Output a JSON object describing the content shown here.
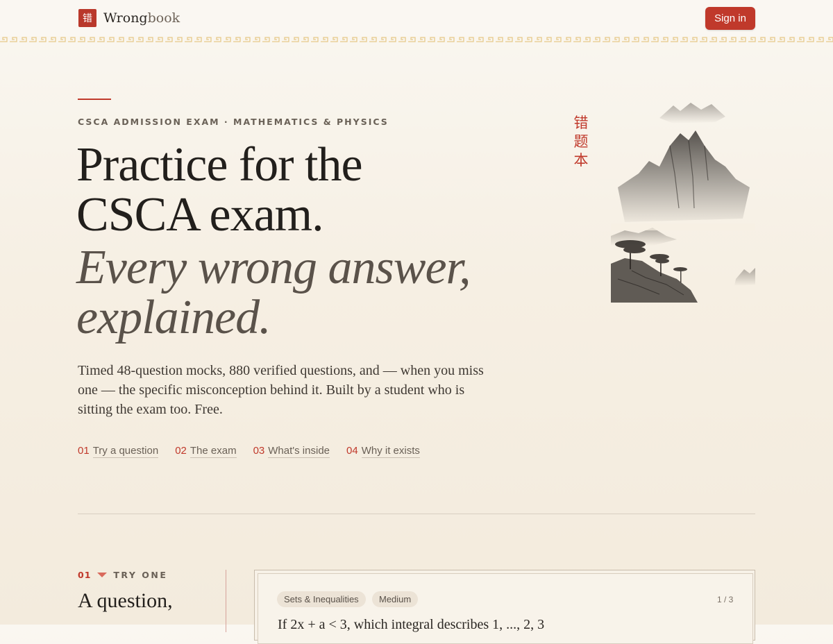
{
  "header": {
    "logo_glyph": "错",
    "brand_main": "Wrong",
    "brand_rest": "book",
    "signin_label": "Sign in"
  },
  "hero": {
    "eyebrow": "CSCA ADMISSION EXAM · MATHEMATICS & PHYSICS",
    "title_line1": "Practice for the",
    "title_line2": "CSCA exam.",
    "title_italic_line1": "Every wrong answer,",
    "title_italic_line2": "explained.",
    "lede": "Timed 48-question mocks, 880 verified questions, and — when you miss one — the specific misconception behind it. Built by a student who is sitting the exam too. Free.",
    "vertical_chars": [
      "错",
      "题",
      "本"
    ],
    "nav": [
      {
        "num": "01",
        "label": "Try a question"
      },
      {
        "num": "02",
        "label": "The exam"
      },
      {
        "num": "03",
        "label": "What's inside"
      },
      {
        "num": "04",
        "label": "Why it exists"
      }
    ]
  },
  "section": {
    "num": "01",
    "label": "TRY ONE",
    "title": "A question,",
    "card": {
      "tags": [
        "Sets & Inequalities",
        "Medium"
      ],
      "counter": "1 / 3",
      "question_start": "If 2x + a < 3, which integral describes 1, ..., 2, 3"
    }
  },
  "colors": {
    "accent": "#c0392b",
    "paper": "#f6efe3",
    "ink": "#221f1c"
  }
}
